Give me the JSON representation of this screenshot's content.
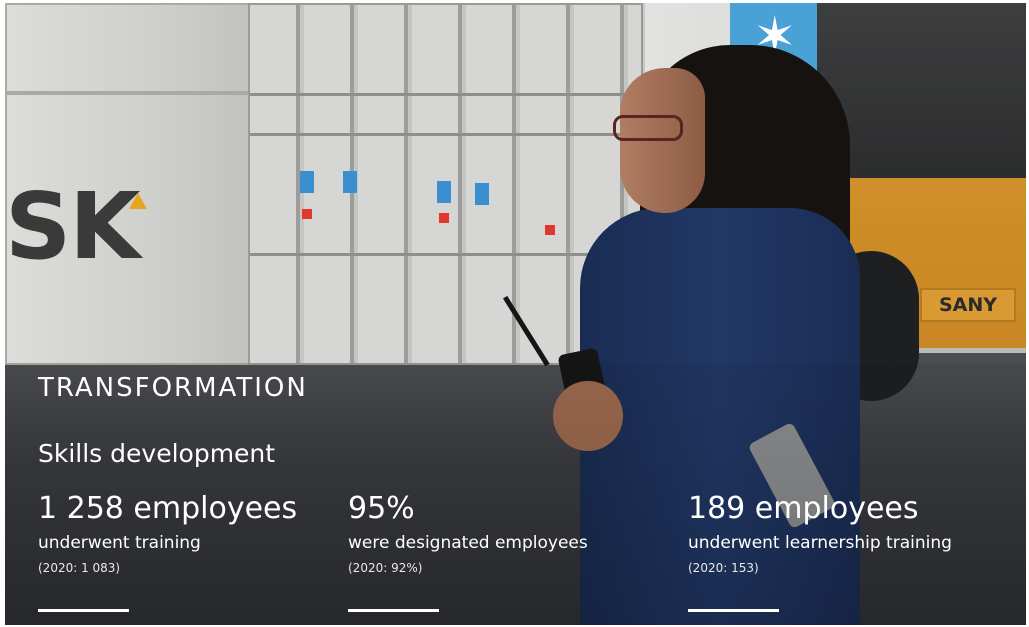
{
  "section": {
    "label": "TRANSFORMATION",
    "heading": "Skills development"
  },
  "stats": [
    {
      "value": "1 258 employees",
      "description": "underwent training",
      "prior": "(2020: 1 083)"
    },
    {
      "value": "95%",
      "description": "were designated employees",
      "prior": "(2020: 92%)"
    },
    {
      "value": "189 employees",
      "description": "underwent learnership training",
      "prior": "(2020: 153)"
    }
  ],
  "photo": {
    "container_text": "SK",
    "vehicle_brand": "SANY"
  },
  "colors": {
    "text": "#ffffff",
    "accent_blue": "#4aa1d6",
    "jacket_navy": "#213866",
    "vehicle_orange": "#d08f2a"
  }
}
